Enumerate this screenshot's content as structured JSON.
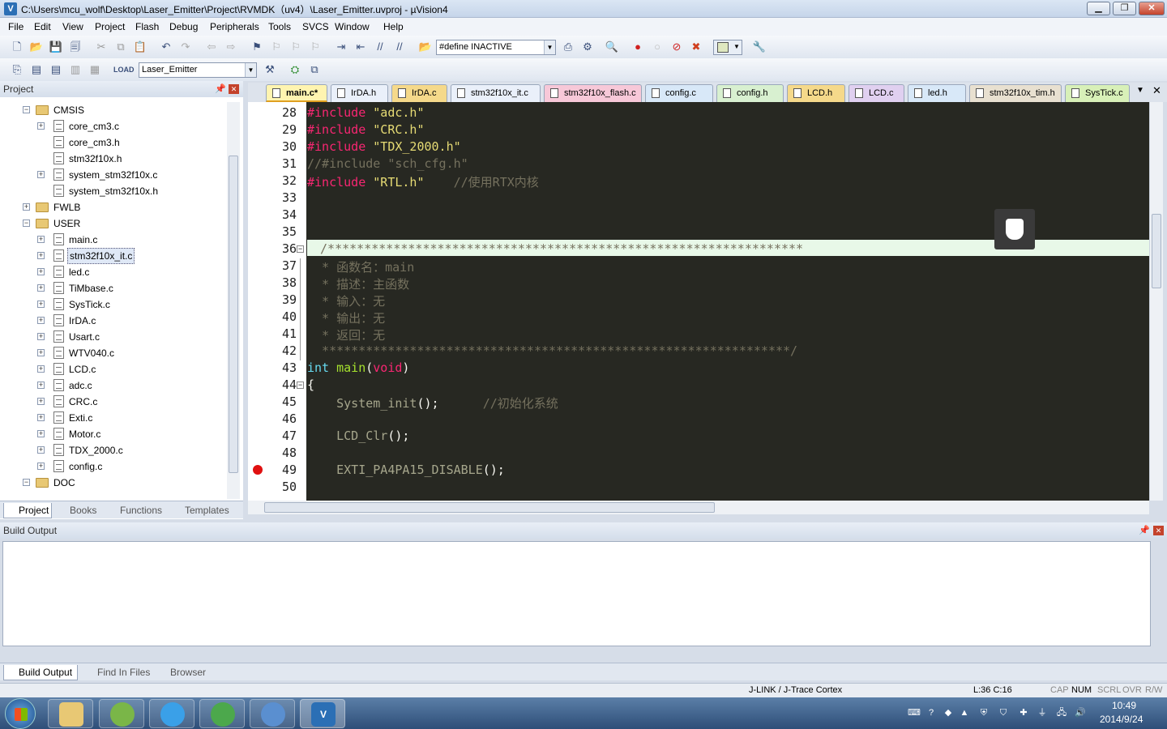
{
  "window": {
    "title": "C:\\Users\\mcu_wolf\\Desktop\\Laser_Emitter\\Project\\RVMDK（uv4）\\Laser_Emitter.uvproj - µVision4"
  },
  "menu": [
    "File",
    "Edit",
    "View",
    "Project",
    "Flash",
    "Debug",
    "Peripherals",
    "Tools",
    "SVCS",
    "Window",
    "Help"
  ],
  "toolbar": {
    "find_combo": "#define INACTIVE",
    "target_combo": "Laser_Emitter"
  },
  "project_pane": {
    "title": "Project",
    "tree": [
      {
        "label": "CMSIS",
        "type": "folder",
        "level": 1,
        "expanded": true
      },
      {
        "label": "core_cm3.c",
        "type": "file",
        "level": 2,
        "expandable": true
      },
      {
        "label": "core_cm3.h",
        "type": "file",
        "level": 2
      },
      {
        "label": "stm32f10x.h",
        "type": "file",
        "level": 2
      },
      {
        "label": "system_stm32f10x.c",
        "type": "file",
        "level": 2,
        "expandable": true
      },
      {
        "label": "system_stm32f10x.h",
        "type": "file",
        "level": 2
      },
      {
        "label": "FWLB",
        "type": "folder",
        "level": 1
      },
      {
        "label": "USER",
        "type": "folder",
        "level": 1,
        "expanded": true
      },
      {
        "label": "main.c",
        "type": "file",
        "level": 2,
        "expandable": true
      },
      {
        "label": "stm32f10x_it.c",
        "type": "file",
        "level": 2,
        "expandable": true,
        "selected": true
      },
      {
        "label": "led.c",
        "type": "file",
        "level": 2,
        "expandable": true
      },
      {
        "label": "TiMbase.c",
        "type": "file",
        "level": 2,
        "expandable": true
      },
      {
        "label": "SysTick.c",
        "type": "file",
        "level": 2,
        "expandable": true
      },
      {
        "label": "IrDA.c",
        "type": "file",
        "level": 2,
        "expandable": true
      },
      {
        "label": "Usart.c",
        "type": "file",
        "level": 2,
        "expandable": true
      },
      {
        "label": "WTV040.c",
        "type": "file",
        "level": 2,
        "expandable": true
      },
      {
        "label": "LCD.c",
        "type": "file",
        "level": 2,
        "expandable": true
      },
      {
        "label": "adc.c",
        "type": "file",
        "level": 2,
        "expandable": true
      },
      {
        "label": "CRC.c",
        "type": "file",
        "level": 2,
        "expandable": true
      },
      {
        "label": "Exti.c",
        "type": "file",
        "level": 2,
        "expandable": true
      },
      {
        "label": "Motor.c",
        "type": "file",
        "level": 2,
        "expandable": true
      },
      {
        "label": "TDX_2000.c",
        "type": "file",
        "level": 2,
        "expandable": true
      },
      {
        "label": "config.c",
        "type": "file",
        "level": 2,
        "expandable": true
      },
      {
        "label": "DOC",
        "type": "folder",
        "level": 1,
        "expanded": true
      }
    ],
    "tabs": [
      "Project",
      "Books",
      "Functions",
      "Templates"
    ]
  },
  "editor": {
    "tabs": [
      "main.c*",
      "IrDA.h",
      "IrDA.c",
      "stm32f10x_it.c",
      "stm32f10x_flash.c",
      "config.c",
      "config.h",
      "LCD.h",
      "LCD.c",
      "led.h",
      "stm32f10x_tim.h",
      "SysTick.c"
    ],
    "line_numbers": [
      "28",
      "29",
      "30",
      "31",
      "32",
      "33",
      "34",
      "35",
      "36",
      "37",
      "38",
      "39",
      "40",
      "41",
      "42",
      "43",
      "44",
      "45",
      "46",
      "47",
      "48",
      "49",
      "50"
    ],
    "lines": [
      [
        [
          "k",
          "#include "
        ],
        [
          "s",
          "\"adc.h\""
        ]
      ],
      [
        [
          "k",
          "#include "
        ],
        [
          "s",
          "\"CRC.h\""
        ]
      ],
      [
        [
          "k",
          "#include "
        ],
        [
          "s",
          "\"TDX_2000.h\""
        ]
      ],
      [
        [
          "c",
          "//#include \"sch_cfg.h\""
        ]
      ],
      [
        [
          "k",
          "#include "
        ],
        [
          "s",
          "\"RTL.h\""
        ],
        [
          "c",
          "    //使用RTX内核"
        ]
      ],
      [],
      [],
      [],
      [
        [
          "c",
          " /*****************************************************************"
        ]
      ],
      [
        [
          "c",
          "  * 函数名：main"
        ]
      ],
      [
        [
          "c",
          "  * 描述：主函数"
        ]
      ],
      [
        [
          "c",
          "  * 输入：无"
        ]
      ],
      [
        [
          "c",
          "  * 输出：无"
        ]
      ],
      [
        [
          "c",
          "  * 返回：无"
        ]
      ],
      [
        [
          "c",
          "  ****************************************************************/"
        ]
      ],
      [
        [
          "t",
          "int "
        ],
        [
          "fn",
          "main"
        ],
        [
          "",
          "("
        ],
        [
          "k",
          "void"
        ],
        [
          "",
          ")"
        ]
      ],
      [
        [
          "",
          "{"
        ]
      ],
      [
        [
          "g",
          "    System_init"
        ],
        [
          "",
          "();      "
        ],
        [
          "c",
          "//初始化系统"
        ]
      ],
      [],
      [
        [
          "g",
          "    LCD_Clr"
        ],
        [
          "",
          "();"
        ]
      ],
      [],
      [
        [
          "g",
          "    EXTI_PA4PA15_DISABLE"
        ],
        [
          "",
          "();"
        ]
      ],
      []
    ]
  },
  "build_output": {
    "title": "Build Output",
    "tabs": [
      "Build Output",
      "Find In Files",
      "Browser"
    ]
  },
  "status": {
    "debugger": "J-LINK / J-Trace Cortex",
    "position": "L:36 C:16",
    "cap": "CAP",
    "num": "NUM",
    "scrl": "SCRL",
    "ovr": "OVR",
    "rw": "R/W"
  },
  "clock": {
    "time": "10:49",
    "date": "2014/9/24"
  },
  "colors": {
    "editor_bg": "#272822",
    "keyword": "#f92672",
    "string": "#e6db74",
    "comment": "#75715e",
    "highlight_line": "#e8f8e8"
  }
}
